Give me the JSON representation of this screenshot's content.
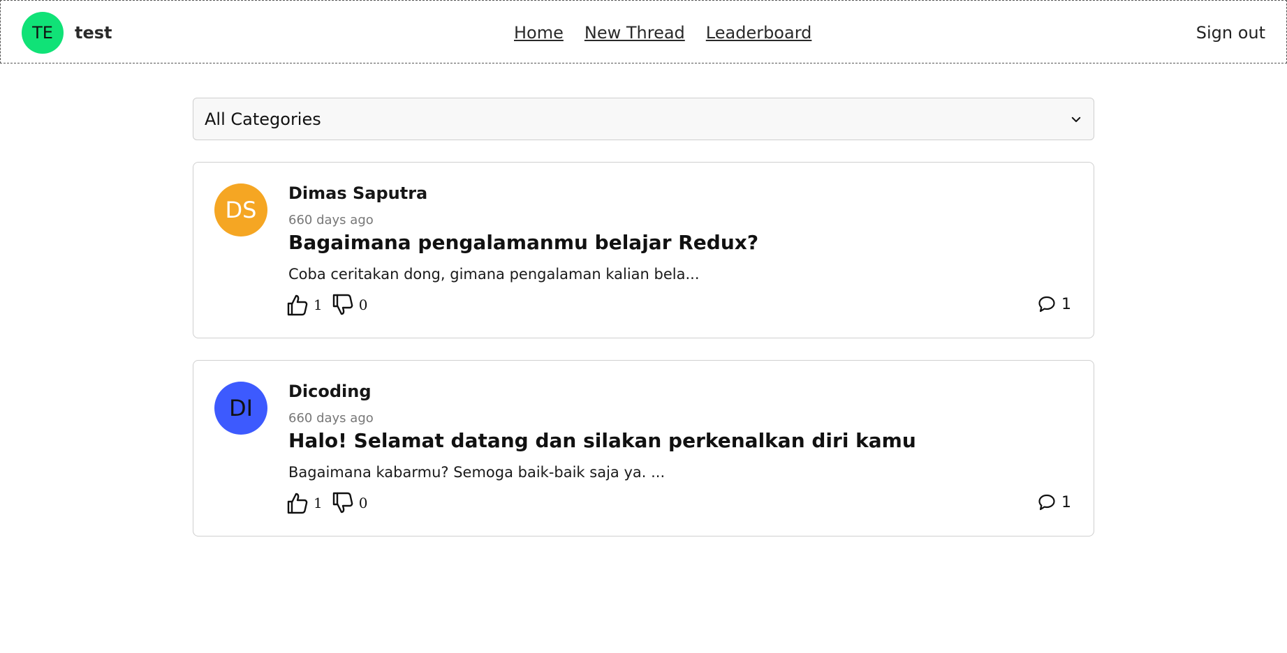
{
  "header": {
    "user": {
      "initials": "TE",
      "name": "test",
      "avatar_color": "#10e277"
    },
    "nav": [
      {
        "label": "Home"
      },
      {
        "label": "New Thread"
      },
      {
        "label": "Leaderboard"
      }
    ],
    "signout_label": "Sign out"
  },
  "filter": {
    "selected": "All Categories"
  },
  "threads": [
    {
      "owner": "Dimas Saputra",
      "initials": "DS",
      "avatar_color": "#f5a623",
      "time": "660 days ago",
      "title": "Bagaimana pengalamanmu belajar Redux?",
      "body": "Coba ceritakan dong, gimana pengalaman kalian bela...",
      "upvotes": "1",
      "downvotes": "0",
      "comments": "1"
    },
    {
      "owner": "Dicoding",
      "initials": "DI",
      "avatar_color": "#3d5afe",
      "time": "660 days ago",
      "title": "Halo! Selamat datang dan silakan perkenalkan diri kamu",
      "body": "Bagaimana kabarmu? Semoga baik-baik saja ya. ...",
      "upvotes": "1",
      "downvotes": "0",
      "comments": "1"
    }
  ]
}
